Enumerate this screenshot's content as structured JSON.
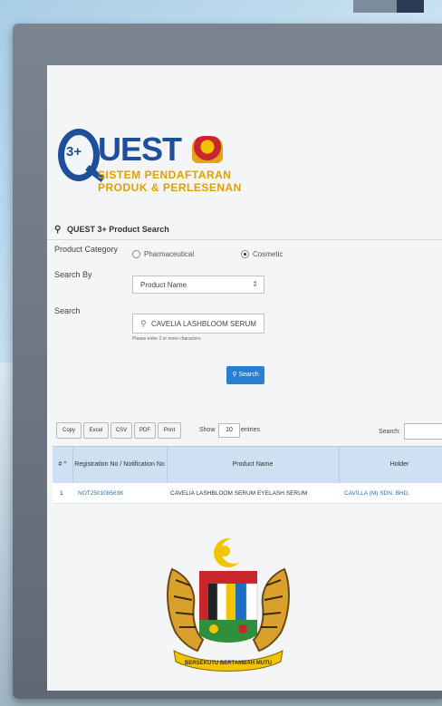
{
  "logo": {
    "q_number": "3+",
    "wordmark": "UEST",
    "subtitle_line1": "SISTEM PENDAFTARAN",
    "subtitle_line2": "PRODUK & PERLESENAN"
  },
  "panel": {
    "title": "QUEST 3+ Product Search"
  },
  "form": {
    "product_category_label": "Product Category",
    "category_options": [
      {
        "label": "Pharmaceutical",
        "selected": false
      },
      {
        "label": "Cosmetic",
        "selected": true
      }
    ],
    "search_by_label": "Search By",
    "search_by_value": "Product Name",
    "search_label": "Search",
    "search_value": "CAVELIA LASHBLOOM SERUM",
    "search_hint": "Please enter 3 or more characters",
    "search_button": "Search"
  },
  "toolbar": {
    "buttons": [
      "Copy",
      "Excel",
      "CSV",
      "PDF",
      "Print"
    ],
    "show_label": "Show",
    "show_value": "10",
    "entries_label": "entries",
    "search_label": "Search:"
  },
  "table": {
    "columns": [
      "# ^",
      "Registration No / Notification No",
      "Product Name",
      "Holder"
    ],
    "rows": [
      [
        "1",
        "NOT250108563K",
        "CAVELIA LASHBLOOM SERUM EYELASH SERUM",
        "CAVILLA (M) SDN. BHD."
      ]
    ]
  },
  "colors": {
    "brand_blue": "#1d4f9c",
    "brand_gold": "#e0a000",
    "button_blue": "#2a7fd4",
    "link_blue": "#2a6fc4",
    "table_header": "#cfe0f2"
  },
  "emblem": {
    "motto": "BERSEKUTU BERTAMBAH MUTU"
  }
}
